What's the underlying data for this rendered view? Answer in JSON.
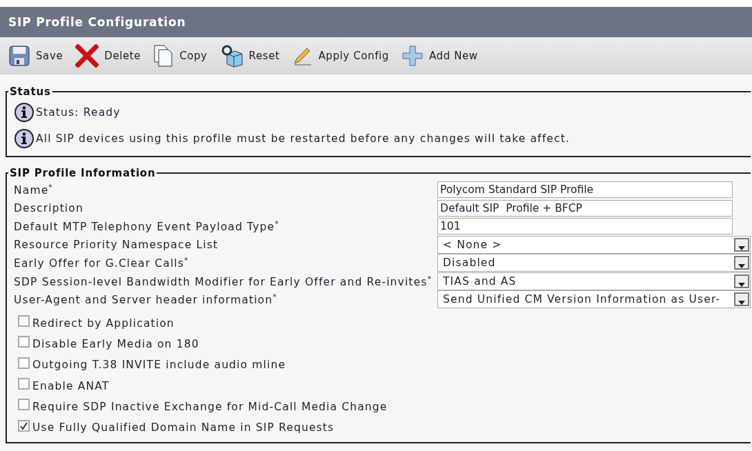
{
  "title": "SIP Profile Configuration",
  "toolbar": [
    {
      "kind": "save",
      "label": "Save"
    },
    {
      "kind": "delete",
      "label": "Delete"
    },
    {
      "kind": "copy",
      "label": "Copy"
    },
    {
      "kind": "reset",
      "label": "Reset"
    },
    {
      "kind": "apply",
      "label": "Apply Config"
    },
    {
      "kind": "add",
      "label": "Add New"
    }
  ],
  "status": {
    "legend": "Status",
    "messages": [
      "Status: Ready",
      "All SIP devices using this profile must be restarted before any changes will take affect."
    ]
  },
  "profile": {
    "legend": "SIP Profile Information",
    "fields": [
      {
        "kind": "text",
        "label": "Name$^{*}$",
        "value": "Polycom Standard SIP Profile"
      },
      {
        "kind": "text",
        "label": "Description",
        "value": "Default SIP  Profile + BFCP"
      },
      {
        "kind": "text",
        "label": "Default MTP Telephony Event Payload Type$^{*}$",
        "value": "101"
      },
      {
        "kind": "select",
        "label": "Resource Priority Namespace List",
        "value": "< None >"
      },
      {
        "kind": "select",
        "label": "Early Offer for G.Clear Calls$^{*}$",
        "value": "Disabled"
      },
      {
        "kind": "select",
        "label": "SDP Session-level Bandwidth Modifier for Early Offer and Re-invites$^{*}$",
        "value": "TIAS and AS"
      },
      {
        "kind": "select",
        "label": "User-Agent and Server header information$^{*}$",
        "value": "Send Unified CM Version Information as User-"
      }
    ],
    "checkboxes": [
      {
        "label": "Redirect by Application",
        "checked": false
      },
      {
        "label": "Disable Early Media on 180",
        "checked": false
      },
      {
        "label": "Outgoing T.38 INVITE include audio mline",
        "checked": false
      },
      {
        "label": "Enable ANAT",
        "checked": false
      },
      {
        "label": "Require SDP Inactive Exchange for Mid-Call Media Change",
        "checked": false
      },
      {
        "label": "Use Fully Qualified Domain Name in SIP Requests",
        "checked": true
      }
    ]
  }
}
